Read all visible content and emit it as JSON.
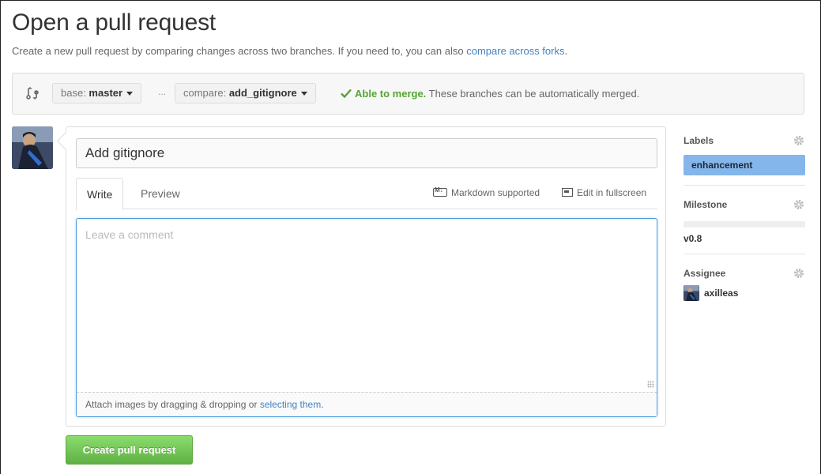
{
  "page": {
    "title": "Open a pull request",
    "subtitle_text": "Create a new pull request by comparing changes across two branches. If you need to, you can also ",
    "subtitle_link": "compare across forks",
    "subtitle_end": "."
  },
  "range": {
    "icon": "git-compare-icon",
    "base_prefix": "base: ",
    "base_branch": "master",
    "separator": "...",
    "compare_prefix": "compare: ",
    "compare_branch": "add_gitignore",
    "merge_status": "Able to merge.",
    "merge_detail": " These branches can be automatically merged.",
    "status_color": "#55a532"
  },
  "form": {
    "title_value": "Add gitignore",
    "tabs": [
      {
        "label": "Write",
        "active": true
      },
      {
        "label": "Preview",
        "active": false
      }
    ],
    "markdown_label": "Markdown supported",
    "fullscreen_label": "Edit in fullscreen",
    "comment_placeholder": "Leave a comment",
    "attach_text": "Attach images by dragging & dropping or ",
    "attach_link": "selecting them",
    "attach_end": ".",
    "submit_label": "Create pull request"
  },
  "sidebar": {
    "labels": {
      "heading": "Labels",
      "items": [
        "enhancement"
      ],
      "label_color": "#84b6eb"
    },
    "milestone": {
      "heading": "Milestone",
      "name": "v0.8",
      "progress": 0
    },
    "assignee": {
      "heading": "Assignee",
      "name": "axilleas"
    }
  },
  "colors": {
    "accent": "#4183c4",
    "button_green": "#60b044"
  }
}
